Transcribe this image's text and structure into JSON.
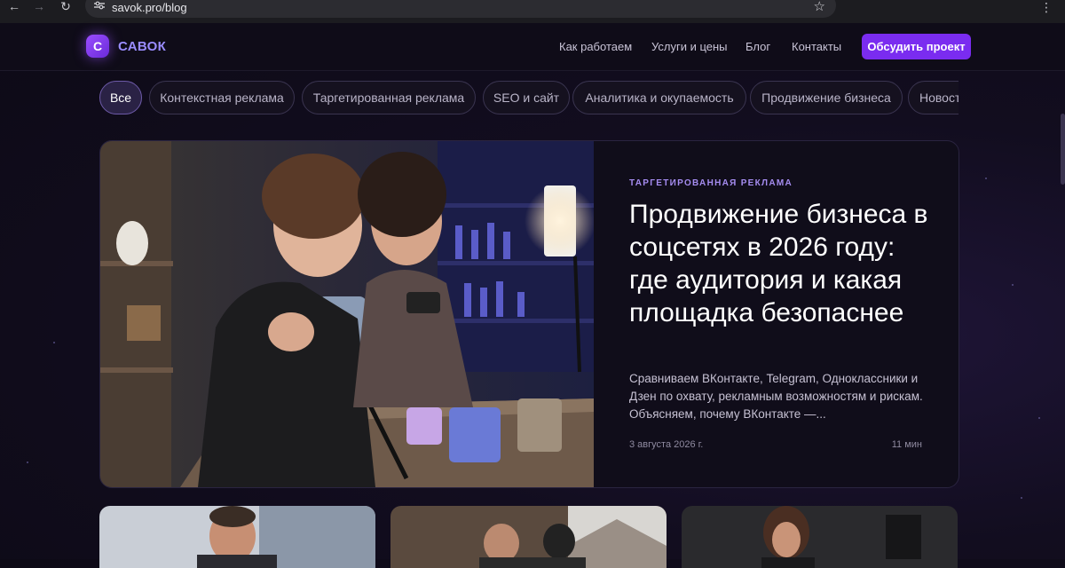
{
  "browser": {
    "url": "savok.pro/blog"
  },
  "header": {
    "logo_letter": "С",
    "logo_text": "САВОК",
    "nav": [
      "Как работаем",
      "Услуги и цены",
      "Блог",
      "Контакты"
    ],
    "cta": "Обсудить проект"
  },
  "filters": {
    "chips": [
      "Все",
      "Контекстная реклама",
      "Таргетированная реклама",
      "SEO и сайт",
      "Аналитика и окупаемость",
      "Продвижение бизнеса",
      "Новости"
    ],
    "active": "Все"
  },
  "featured": {
    "category": "ТАРГЕТИРОВАННАЯ РЕКЛАМА",
    "title": "Продвижение бизнеса в соцсетях в 2026 году: где аудитория и какая площадка безопаснее",
    "excerpt": "Сравниваем ВКонтакте, Telegram, Одноклассники и Дзен по охвату, рекламным возможностям и рискам. Объясняем, почему ВКонтакте —...",
    "date": "3 августа 2026 г.",
    "read_time": "11 мин"
  },
  "colors": {
    "accent": "#7a2cf0",
    "category": "#a58cf0",
    "logo_text": "#9a8dff"
  }
}
